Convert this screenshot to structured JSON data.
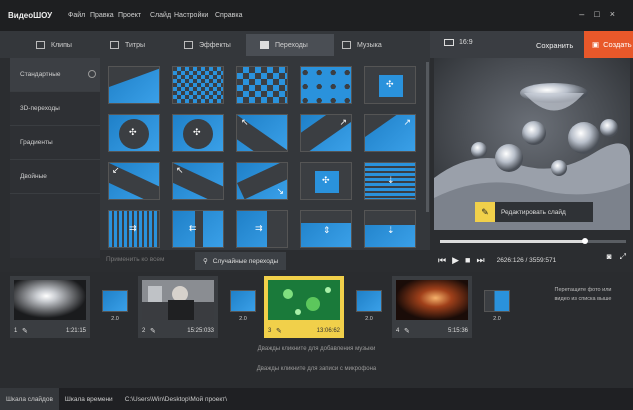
{
  "app": {
    "title": "ВидеоШОУ"
  },
  "menu": [
    "Файл",
    "Правка",
    "Проект",
    "Слайд",
    "Настройки",
    "Справка"
  ],
  "window_controls": [
    "–",
    "□",
    "×"
  ],
  "tabs": [
    {
      "label": "Клипы",
      "icon": "clips-icon"
    },
    {
      "label": "Титры",
      "icon": "titles-icon"
    },
    {
      "label": "Эффекты",
      "icon": "effects-icon"
    },
    {
      "label": "Переходы",
      "icon": "transitions-icon",
      "active": true
    },
    {
      "label": "Музыка",
      "icon": "music-icon"
    }
  ],
  "right_toolbar": {
    "resolution": "16:9",
    "save": "Сохранить",
    "create": "Создать"
  },
  "categories": [
    {
      "label": "Стандартные",
      "active": true
    },
    {
      "label": "3D-переходы"
    },
    {
      "label": "Градиенты"
    },
    {
      "label": "Двойные"
    }
  ],
  "grid_toolbar": {
    "apply_all": "Применить ко всем",
    "random": "Случайные переходы"
  },
  "preview": {
    "edit_slide": "Редактировать слайд",
    "time": "2626:126 / 3559:571",
    "progress": 0.78
  },
  "timeline": {
    "slides": [
      {
        "num": "1",
        "duration": "1:21:15"
      },
      {
        "num": "2",
        "duration": "15:25:033"
      },
      {
        "num": "3",
        "duration": "13:06:62"
      },
      {
        "num": "4",
        "duration": "5:15:36"
      }
    ],
    "transitions": [
      "2.0",
      "2.0",
      "2.0",
      "2.0"
    ],
    "hint": "Перетащите фото или видео из списка выше",
    "music_track": "Дважды кликните для добавления музыки",
    "voice_track": "Дважды кликните для записи с микрофона"
  },
  "bottom": {
    "tab_slides": "Шкала слайдов",
    "tab_timeline": "Шкала времени",
    "path": "C:\\Users\\Win\\Desktop\\Мой проект\\"
  },
  "colors": {
    "accent": "#e8582a",
    "selection": "#f1d04a",
    "transition_blue": "#2a92dc"
  }
}
